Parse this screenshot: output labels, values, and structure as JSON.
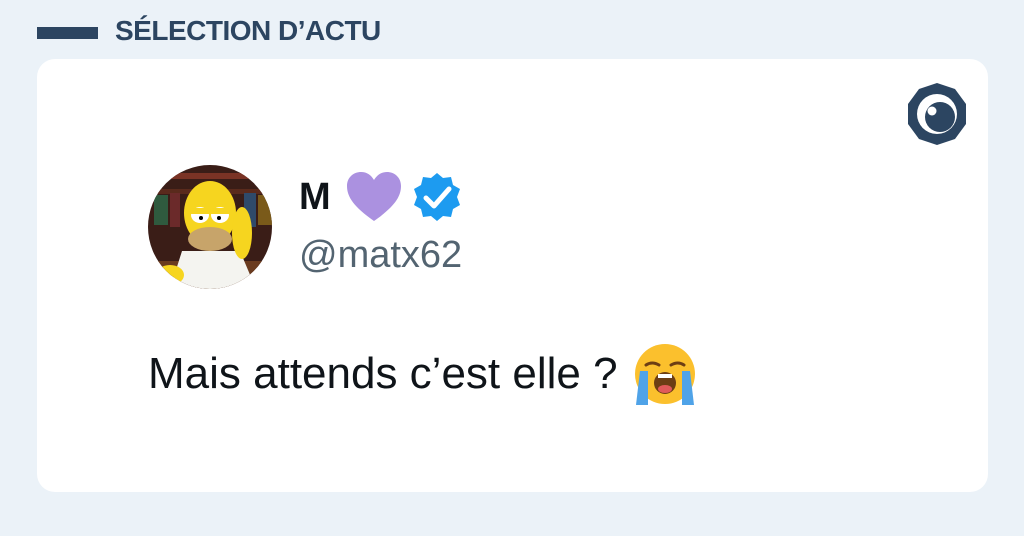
{
  "header": {
    "title": "SÉLECTION D’ACTU"
  },
  "brand": {
    "icon": "eye-logo-icon",
    "color": "#2c4561"
  },
  "tweet": {
    "display_name": "M",
    "name_icons": [
      "purple-heart-icon",
      "verified-badge-icon"
    ],
    "handle": "@matx62",
    "text": "Mais attends c’est elle ?",
    "text_emoji": "loudly-crying-face-icon"
  },
  "colors": {
    "background": "#ebf2f8",
    "accent": "#2c4561",
    "verified": "#1d9bf0",
    "heart": "#ab91e0"
  }
}
